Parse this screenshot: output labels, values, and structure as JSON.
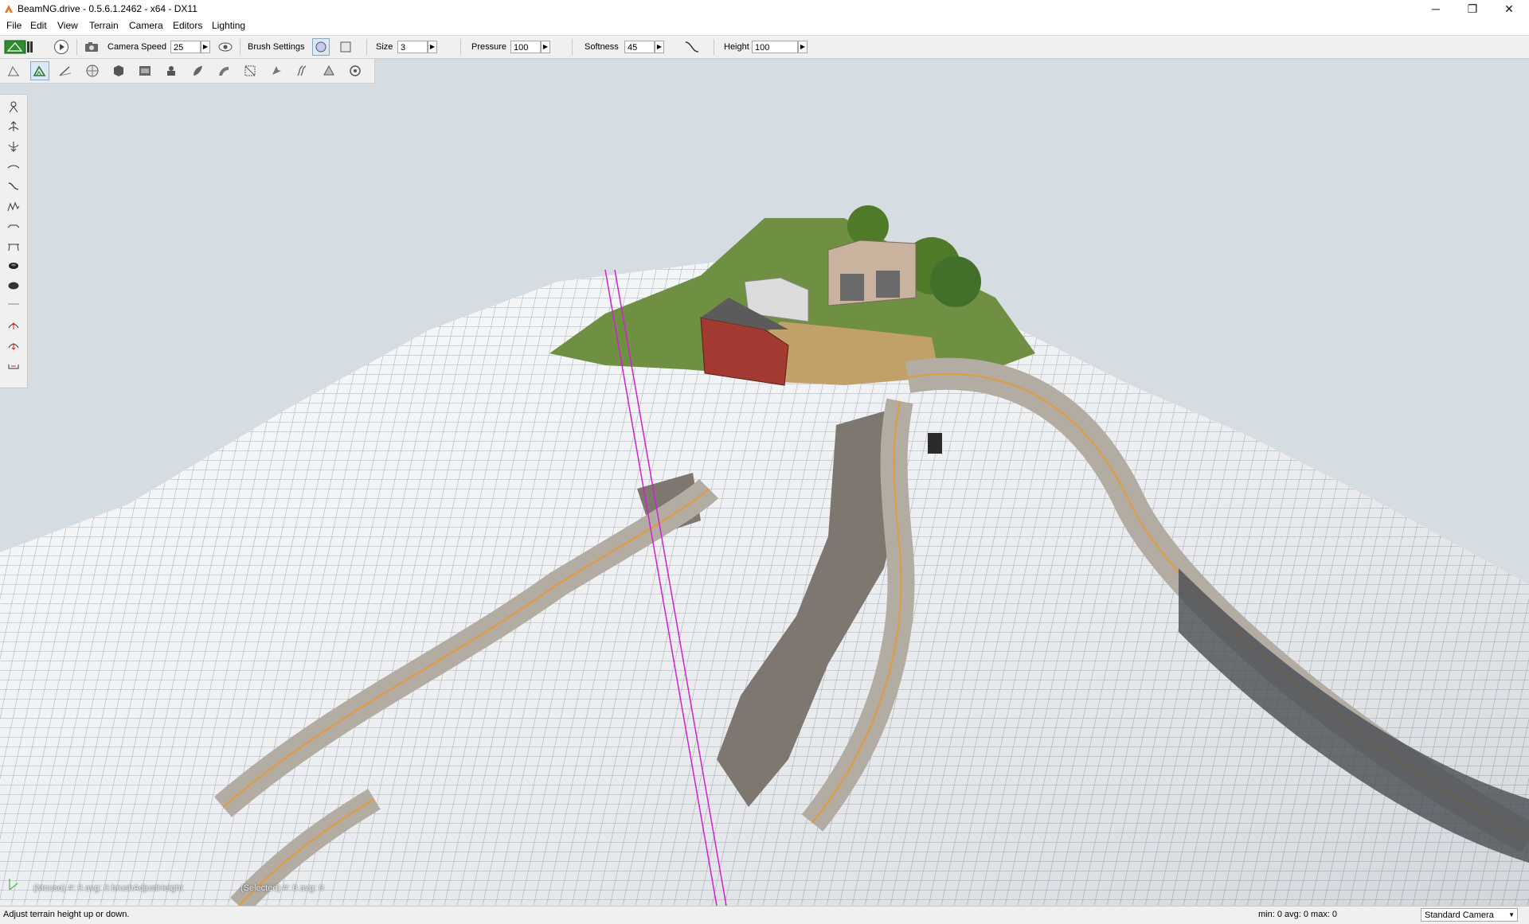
{
  "window": {
    "title": "BeamNG.drive - 0.5.6.1.2462 - x64 - DX11",
    "controls": {
      "minimize": "─",
      "restore": "❐",
      "close": "✕"
    }
  },
  "menu": {
    "items": [
      "File",
      "Edit",
      "View",
      "Terrain",
      "Camera",
      "Editors",
      "Lighting"
    ]
  },
  "toolbar": {
    "camera_speed_label": "Camera Speed",
    "camera_speed_value": "25",
    "brush_settings_label": "Brush Settings",
    "size_label": "Size",
    "size_value": "3",
    "pressure_label": "Pressure",
    "pressure_value": "100",
    "softness_label": "Softness",
    "softness_value": "45",
    "height_label": "Height",
    "height_value": "100",
    "arrow": "▶"
  },
  "tool_icons": {
    "top_row": [
      "object-select-icon",
      "terrain-editor-icon",
      "terrain-painter-icon",
      "world-icon",
      "object-icon",
      "datablock-icon",
      "spawn-icon",
      "forest-icon",
      "road-icon",
      "mesh-icon",
      "decal-icon",
      "river-icon",
      "shape-icon",
      "node-icon"
    ],
    "active_top": "terrain-editor-icon",
    "palette": [
      "grab-terrain-icon",
      "raise-height-icon",
      "lower-height-icon",
      "smooth-height-icon",
      "smooth-slope-icon",
      "paint-noise-icon",
      "flatten-icon",
      "set-height-icon",
      "clear-terrain-icon",
      "restore-terrain-icon",
      "divider",
      "alpha-raise-icon",
      "alpha-lower-icon",
      "set-empty-icon"
    ]
  },
  "viewport": {
    "hud_mouse": "(Mouse) #: 0  avg: 0 brushAdjustHeight",
    "hud_selected": "(Selected) #: 0  avg: 0"
  },
  "status": {
    "message": "Adjust terrain height up or down.",
    "stats": "min: 0  avg: 0  max: 0",
    "camera_mode": "Standard Camera",
    "dropdown": "▼"
  }
}
